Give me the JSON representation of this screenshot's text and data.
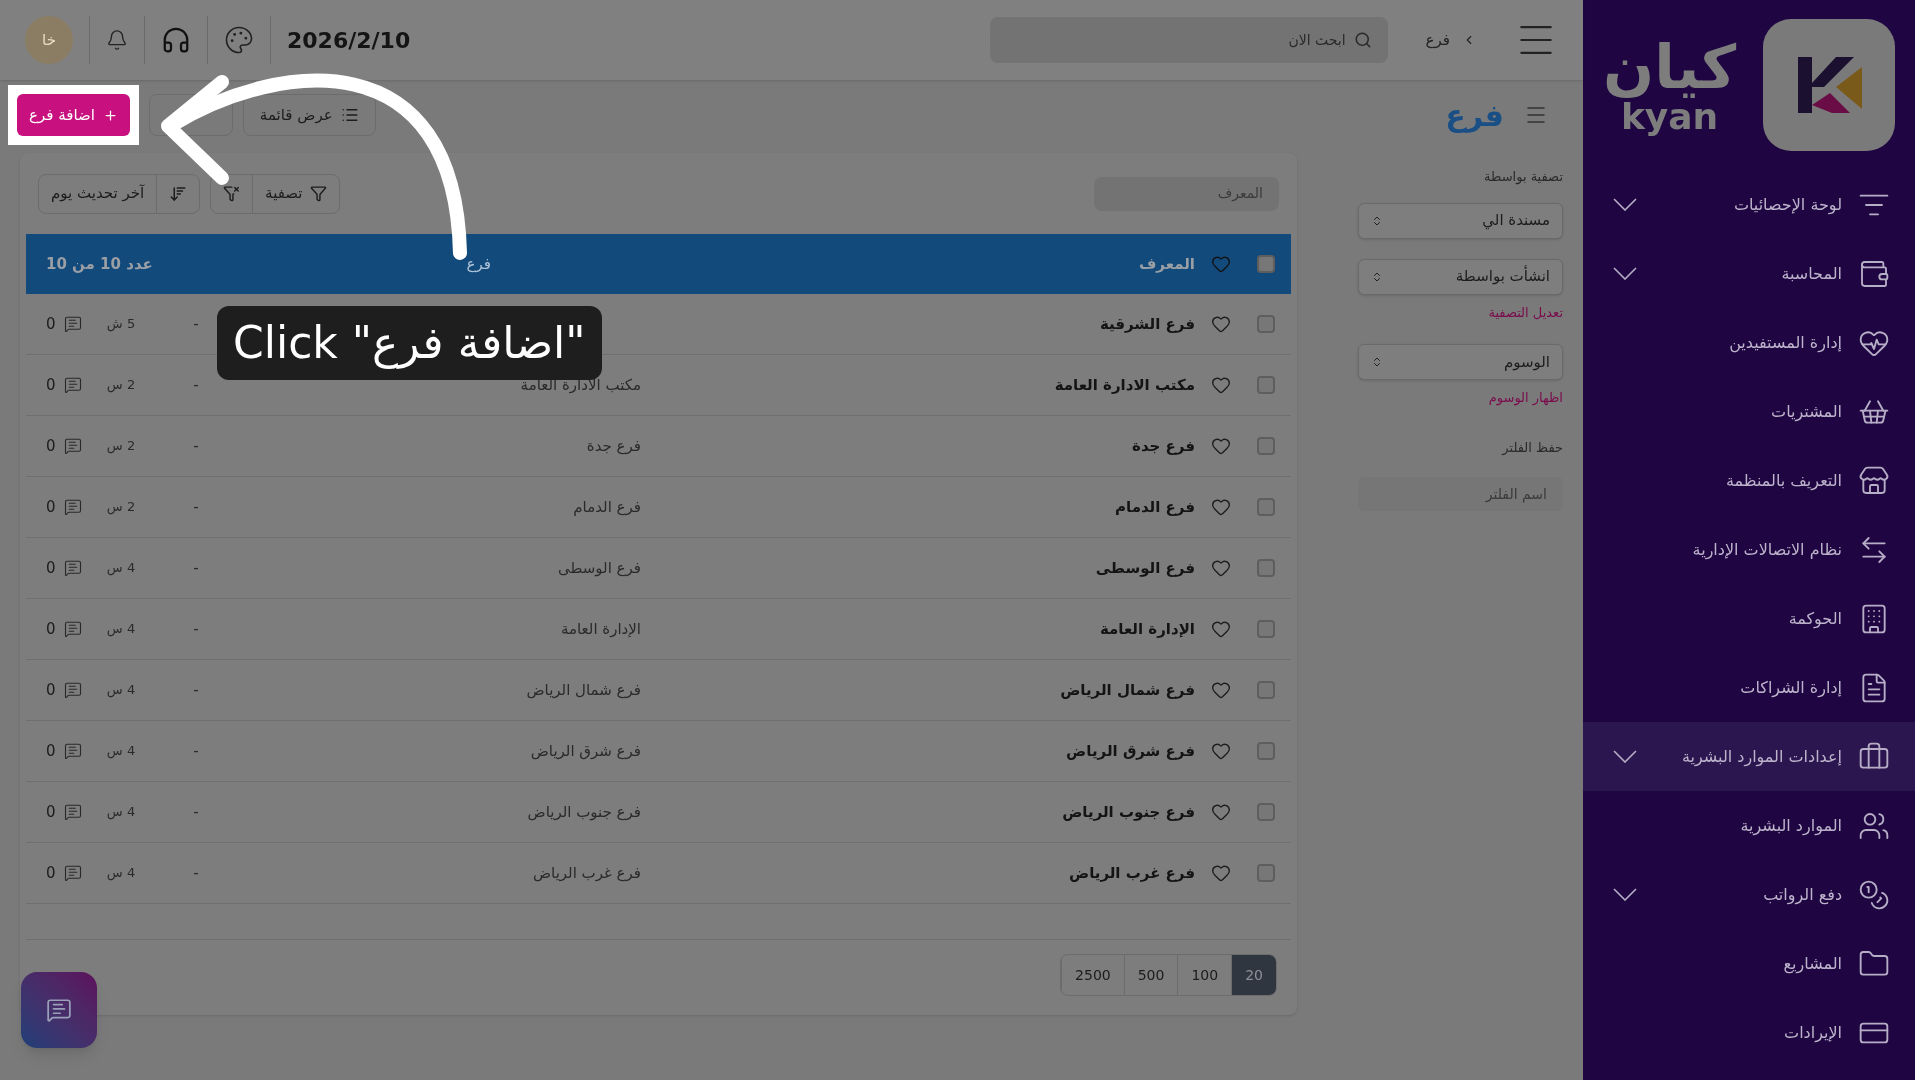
{
  "sidebar": {
    "logo": {
      "arabic": "كيان",
      "latin": "kyan"
    },
    "items": [
      {
        "label": "لوحة الإحصائيات",
        "expandable": true,
        "selected": false
      },
      {
        "label": "المحاسبة",
        "expandable": true,
        "selected": false
      },
      {
        "label": "إدارة المستفيدين",
        "expandable": false,
        "selected": false
      },
      {
        "label": "المشتريات",
        "expandable": false,
        "selected": false
      },
      {
        "label": "التعريف بالمنظمة",
        "expandable": false,
        "selected": false
      },
      {
        "label": "نظام الاتصالات الإدارية",
        "expandable": false,
        "selected": false
      },
      {
        "label": "الحوكمة",
        "expandable": false,
        "selected": false
      },
      {
        "label": "إدارة الشراكات",
        "expandable": false,
        "selected": false
      },
      {
        "label": "إعدادات الموارد البشرية",
        "expandable": true,
        "selected": true
      },
      {
        "label": "الموارد البشرية",
        "expandable": false,
        "selected": false
      },
      {
        "label": "دفع الرواتب",
        "expandable": true,
        "selected": false
      },
      {
        "label": "المشاريع",
        "expandable": false,
        "selected": false
      },
      {
        "label": "الإيرادات",
        "expandable": false,
        "selected": false
      }
    ]
  },
  "top_bar": {
    "breadcrumb": "فرع",
    "search": {
      "placeholder": "ابحث الان"
    },
    "date": "2026/2/10",
    "avatar": "خا"
  },
  "page": {
    "title": "فرع",
    "buttons": {
      "add": "اضافة فرع",
      "list_view": "عرض قائمة"
    }
  },
  "filters": {
    "title": "تصفية بواسطة",
    "selects": [
      "مسندة الي",
      "انشأت بواسطة"
    ],
    "edit_link": "تعديل التصفية",
    "tags_select": "الوسوم",
    "tags_link": "اظهار الوسوم",
    "save_title": "حفظ الفلتر",
    "name_field": {
      "placeholder": "اسم الفلتر"
    }
  },
  "table": {
    "search": {
      "placeholder": "المعرف"
    },
    "filter_button": "تصفية",
    "sort_button": "آخر تحديث يوم",
    "header": {
      "checked": false,
      "column_1": "المعرف",
      "column_2": "فرع",
      "count": "عدد 10 من 10"
    },
    "rows": [
      {
        "name": "فرع الشرقية",
        "description": "",
        "dash": "-",
        "time": "5 ش",
        "comments": "0",
        "checked": false
      },
      {
        "name": "مكتب الادارة العامة",
        "description": "مكتب الادارة العامة",
        "dash": "-",
        "time": "2 س",
        "comments": "0",
        "checked": false
      },
      {
        "name": "فرع جدة",
        "description": "فرع جدة",
        "dash": "-",
        "time": "2 س",
        "comments": "0",
        "checked": false
      },
      {
        "name": "فرع الدمام",
        "description": "فرع الدمام",
        "dash": "-",
        "time": "2 س",
        "comments": "0",
        "checked": false
      },
      {
        "name": "فرع الوسطى",
        "description": "فرع الوسطى",
        "dash": "-",
        "time": "4 س",
        "comments": "0",
        "checked": false
      },
      {
        "name": "الإدارة العامة",
        "description": "الإدارة العامة",
        "dash": "-",
        "time": "4 س",
        "comments": "0",
        "checked": false
      },
      {
        "name": "فرع شمال الرياض",
        "description": "فرع شمال الرياض",
        "dash": "-",
        "time": "4 س",
        "comments": "0",
        "checked": false
      },
      {
        "name": "فرع شرق الرياض",
        "description": "فرع شرق الرياض",
        "dash": "-",
        "time": "4 س",
        "comments": "0",
        "checked": false
      },
      {
        "name": "فرع جنوب الرياض",
        "description": "فرع جنوب الرياض",
        "dash": "-",
        "time": "4 س",
        "comments": "0",
        "checked": false
      },
      {
        "name": "فرع غرب الرياض",
        "description": "فرع غرب الرياض",
        "dash": "-",
        "time": "4 س",
        "comments": "0",
        "checked": false
      }
    ],
    "page_sizes": [
      {
        "label": "20",
        "selected": true
      },
      {
        "label": "100",
        "selected": false
      },
      {
        "label": "500",
        "selected": false
      },
      {
        "label": "2500",
        "selected": false
      }
    ]
  },
  "tutorial": {
    "tooltip": "Click \"اضافة فرع\""
  }
}
